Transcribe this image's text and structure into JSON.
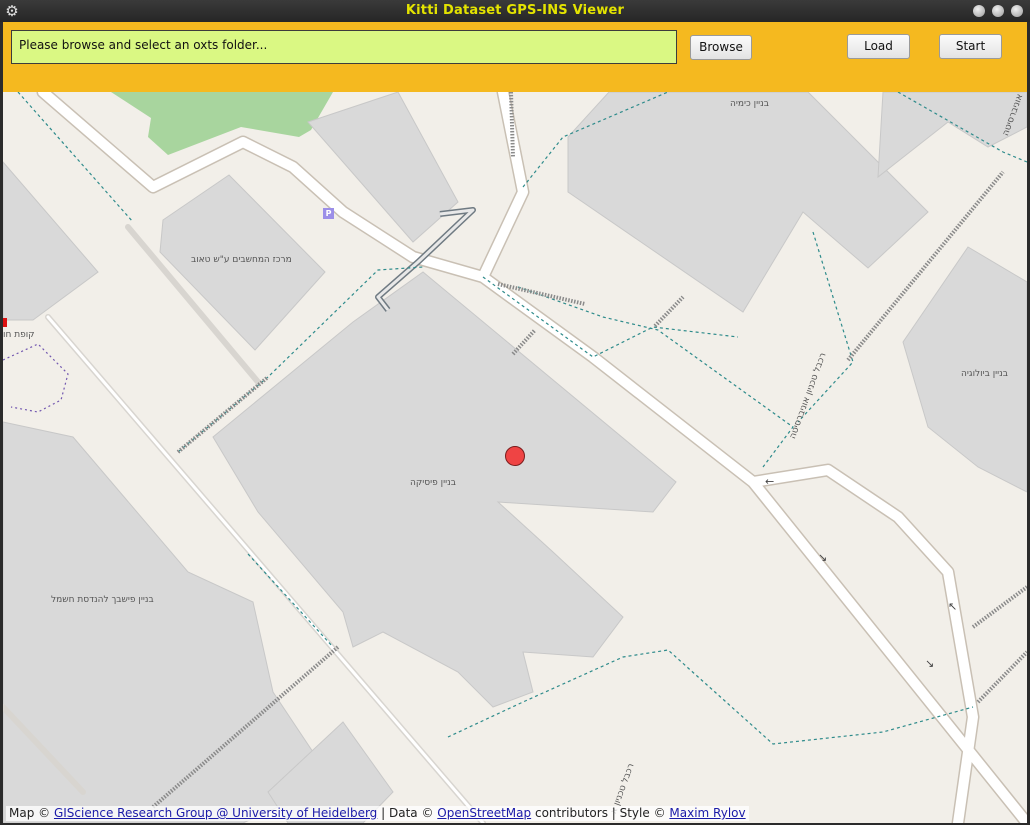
{
  "window": {
    "title": "Kitti Dataset GPS-INS Viewer"
  },
  "toolbar": {
    "path_text": "Please browse and select an oxts folder...",
    "browse_label": "Browse",
    "load_label": "Load",
    "start_label": "Start"
  },
  "map": {
    "labels": {
      "chemistry": "בניין כימיה",
      "computer_center": "מרכז המחשבים ע\"ש טאוב",
      "physics": "בניין פיסיקה",
      "biology": "בניין ביולוגיה",
      "electrical": "בניין פישבך להנדסת חשמל",
      "kupat": "קופת חו",
      "street_1": "רכבל טכניון אוניברסיטה",
      "street_2": "רכבל טכניון א",
      "street_3": "אוניברסיטה",
      "parking": "P"
    },
    "attribution": {
      "map_prefix": "Map ©",
      "giscience": "GIScience Research Group @ University of Heidelberg",
      "data_sep": "| Data ©",
      "osm": "OpenStreetMap",
      "contributors": "contributors | Style ©",
      "author": "Maxim Rylov"
    },
    "colors": {
      "background": "#f2efe9",
      "building": "#d9d9d9",
      "park": "#a8d59e",
      "path": "#2e8b8b",
      "marker": "#ef4444"
    }
  }
}
